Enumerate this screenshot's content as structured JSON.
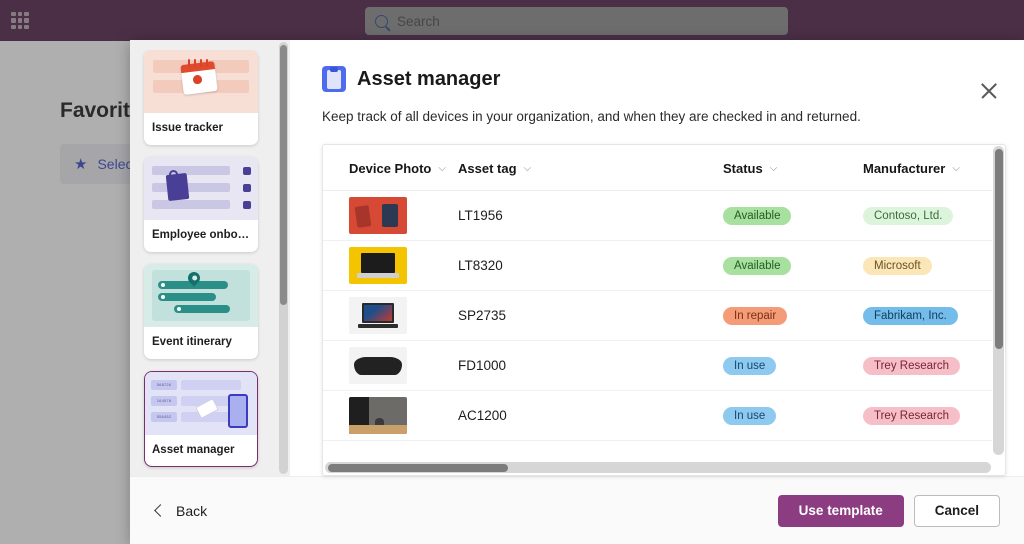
{
  "topbar": {
    "waffle_icon": "app-launcher-grid-icon",
    "search": {
      "icon": "search-icon",
      "placeholder": "Search",
      "value": ""
    }
  },
  "background_page": {
    "title": "Favorit",
    "button": {
      "icon": "star-icon",
      "label": "Select"
    }
  },
  "modal": {
    "close_icon": "close-icon",
    "header": {
      "icon": "clipboard-icon",
      "title": "Asset manager",
      "subtitle": "Keep track of all devices in your organization, and when they are checked in and returned."
    },
    "templates": [
      {
        "name": "Issue tracker",
        "art": "issue",
        "selected": false
      },
      {
        "name": "Employee onbo…",
        "art": "emp",
        "selected": false
      },
      {
        "name": "Event itinerary",
        "art": "event",
        "selected": false
      },
      {
        "name": "Asset manager",
        "art": "asset",
        "selected": true
      }
    ],
    "table": {
      "columns": [
        {
          "label": "Device Photo",
          "sort_icon": "chevron-down-icon"
        },
        {
          "label": "Asset tag",
          "sort_icon": "chevron-down-icon"
        },
        {
          "label": "Status",
          "sort_icon": "chevron-down-icon"
        },
        {
          "label": "Manufacturer",
          "sort_icon": "chevron-down-icon"
        }
      ],
      "rows": [
        {
          "photo": "tablet",
          "asset_tag": "LT1956",
          "status": "Available",
          "status_bg": "#a8e0a0",
          "status_fg": "#235c1f",
          "manufacturer": "Contoso, Ltd.",
          "man_bg": "#ddf4dc",
          "man_fg": "#3c6d38"
        },
        {
          "photo": "laptop-y",
          "asset_tag": "LT8320",
          "status": "Available",
          "status_bg": "#a8e0a0",
          "status_fg": "#235c1f",
          "manufacturer": "Microsoft",
          "man_bg": "#fbe6b8",
          "man_fg": "#6b5320"
        },
        {
          "photo": "laptop-g",
          "asset_tag": "SP2735",
          "status": "In repair",
          "status_bg": "#f49c78",
          "status_fg": "#7a2f12",
          "manufacturer": "Fabrikam, Inc.",
          "man_bg": "#74bdea",
          "man_fg": "#123c5c"
        },
        {
          "photo": "kbd",
          "asset_tag": "FD1000",
          "status": "In use",
          "status_bg": "#8ec9ef",
          "status_fg": "#17486e",
          "manufacturer": "Trey Research",
          "man_bg": "#f6bfc8",
          "man_fg": "#7a2338"
        },
        {
          "photo": "desk",
          "asset_tag": "AC1200",
          "status": "In use",
          "status_bg": "#8ec9ef",
          "status_fg": "#17486e",
          "manufacturer": "Trey Research",
          "man_bg": "#f6bfc8",
          "man_fg": "#7a2338"
        }
      ]
    },
    "footer": {
      "back": {
        "icon": "chevron-left-icon",
        "label": "Back"
      },
      "use_template": "Use template",
      "cancel": "Cancel"
    }
  },
  "colors": {
    "brand_purple": "#53244a",
    "accent_purple": "#8c3d82",
    "selected_border": "#7b2d6e"
  }
}
